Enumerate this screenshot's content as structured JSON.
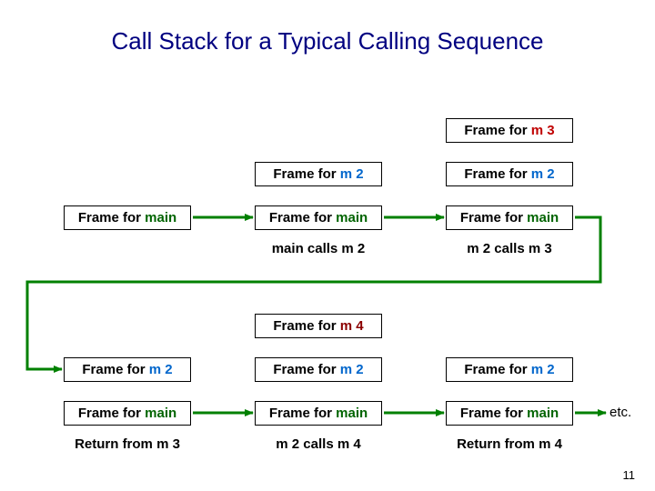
{
  "title": "Call Stack for a Typical Calling Sequence",
  "words": {
    "frame_for": "Frame for ",
    "main": "main",
    "m2": "m 2",
    "m3": "m 3",
    "m4": "m 4"
  },
  "captions": {
    "main_calls_m2": "main calls m 2",
    "m2_calls_m3": "m 2 calls m 3",
    "return_from_m3": "Return from m 3",
    "m2_calls_m4": "m 2 calls m 4",
    "return_from_m4": "Return from m 4"
  },
  "etc": "etc.",
  "page": "11",
  "colors": {
    "arrow_green": "#008000",
    "title_navy": "#000080",
    "m3_red": "#c00000",
    "m2_blue": "#0066cc",
    "main_green": "#006400",
    "m4_darkred": "#8B0000"
  }
}
